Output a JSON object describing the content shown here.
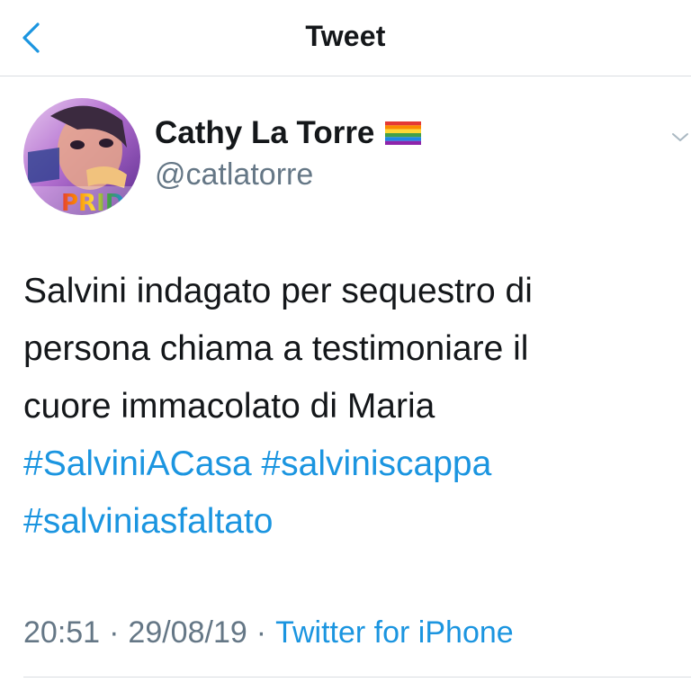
{
  "navbar": {
    "title": "Tweet",
    "back_icon": "chevron-left-icon"
  },
  "author": {
    "name": "Cathy La Torre",
    "handle": "@catlatorre",
    "name_flag_icon": "rainbow-flag-icon",
    "avatar_text": "PRIDE"
  },
  "tweet": {
    "lines": [
      "Salvini indagato per sequestro di",
      "persona chiama a testimoniare il",
      "cuore immacolato di Maria"
    ],
    "hashtags": [
      "#SalviniACasa",
      "#salviniscappa",
      "#salviniasfaltato"
    ]
  },
  "meta": {
    "time": "20:51",
    "separator": "·",
    "date": "29/08/19",
    "source": "Twitter for iPhone"
  },
  "colors": {
    "link": "#1b95e0",
    "text": "#14171a",
    "secondary": "#657786",
    "divider": "#d9dde1"
  }
}
